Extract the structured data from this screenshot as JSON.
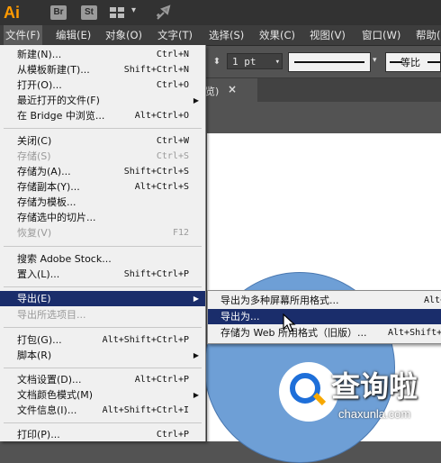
{
  "app": {
    "logo": "Ai",
    "bridge_btn": "Br",
    "stock_btn": "St",
    "accent": "#ff9a00"
  },
  "menubar": [
    {
      "label": "文件(F)",
      "active": true
    },
    {
      "label": "编辑(E)"
    },
    {
      "label": "对象(O)"
    },
    {
      "label": "文字(T)"
    },
    {
      "label": "选择(S)"
    },
    {
      "label": "效果(C)"
    },
    {
      "label": "视图(V)"
    },
    {
      "label": "窗口(W)"
    },
    {
      "label": "帮助(H)"
    }
  ],
  "controlbar": {
    "stroke_weight": "1 pt",
    "ratio_label": "等比"
  },
  "doc_tab": {
    "label": "览)",
    "close_icon": "×"
  },
  "file_menu": {
    "items": [
      {
        "label": "新建(N)...",
        "shortcut": "Ctrl+N"
      },
      {
        "label": "从模板新建(T)...",
        "shortcut": "Shift+Ctrl+N"
      },
      {
        "label": "打开(O)...",
        "shortcut": "Ctrl+O"
      },
      {
        "label": "最近打开的文件(F)",
        "submenu": true
      },
      {
        "label": "在 Bridge 中浏览...",
        "shortcut": "Alt+Ctrl+O"
      },
      {
        "label": "关闭(C)",
        "shortcut": "Ctrl+W"
      },
      {
        "label": "存储(S)",
        "shortcut": "Ctrl+S",
        "disabled": true
      },
      {
        "label": "存储为(A)...",
        "shortcut": "Shift+Ctrl+S"
      },
      {
        "label": "存储副本(Y)...",
        "shortcut": "Alt+Ctrl+S"
      },
      {
        "label": "存储为模板..."
      },
      {
        "label": "存储选中的切片..."
      },
      {
        "label": "恢复(V)",
        "shortcut": "F12",
        "disabled": true
      },
      {
        "label": "搜索 Adobe Stock..."
      },
      {
        "label": "置入(L)...",
        "shortcut": "Shift+Ctrl+P"
      },
      {
        "label": "导出(E)",
        "submenu": true,
        "highlighted": true
      },
      {
        "label": "导出所选项目...",
        "disabled": true
      },
      {
        "label": "打包(G)...",
        "shortcut": "Alt+Shift+Ctrl+P"
      },
      {
        "label": "脚本(R)",
        "submenu": true
      },
      {
        "label": "文档设置(D)...",
        "shortcut": "Alt+Ctrl+P"
      },
      {
        "label": "文档颜色模式(M)",
        "submenu": true
      },
      {
        "label": "文件信息(I)...",
        "shortcut": "Alt+Shift+Ctrl+I"
      },
      {
        "label": "打印(P)...",
        "shortcut": "Ctrl+P"
      }
    ]
  },
  "export_submenu": {
    "items": [
      {
        "label": "导出为多种屏幕所用格式...",
        "shortcut": "Alt+"
      },
      {
        "label": "导出为...",
        "highlighted": true
      },
      {
        "label": "存储为 Web 所用格式（旧版）...",
        "shortcut": "Alt+Shift+"
      }
    ]
  },
  "watermark": {
    "title": "查询啦",
    "subtitle": "chaxunla.com",
    "blue": "#1e6fd9",
    "orange": "#f7a800"
  },
  "colors": {
    "menu_highlight": "#1a2d6b",
    "circle_fill": "#6e9fd6"
  }
}
